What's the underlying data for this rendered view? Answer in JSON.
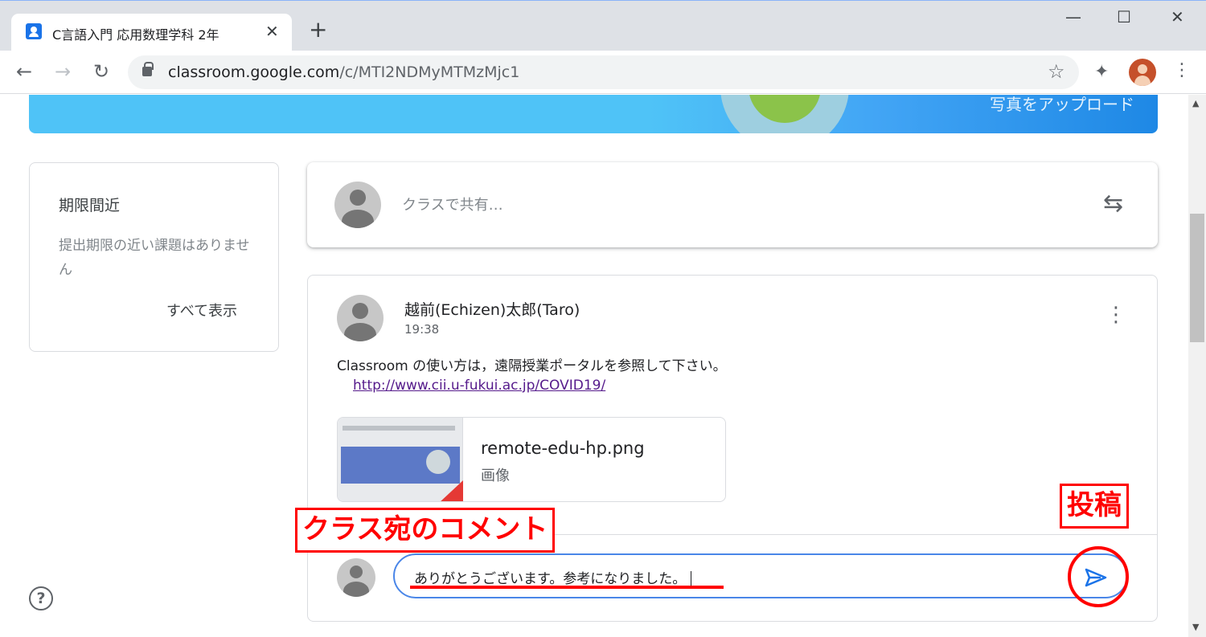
{
  "browser": {
    "tab_title": "C言語入門 応用数理学科 2年",
    "tab_close": "✕",
    "new_tab": "+",
    "window_minimize": "—",
    "window_maximize": "☐",
    "window_close": "✕",
    "url_host": "classroom.google.com",
    "url_path": "/c/MTI2NDMyMTMzMjc1"
  },
  "banner": {
    "upload_label": "写真をアップロード"
  },
  "upcoming": {
    "title": "期限間近",
    "body": "提出期限の近い課題はありません",
    "view_all": "すべて表示"
  },
  "share": {
    "placeholder": "クラスで共有…"
  },
  "post": {
    "author": "越前(Echizen)太郎(Taro)",
    "time": "19:38",
    "body": "Classroom の使い方は，遠隔授業ポータルを参照して下さい。",
    "link": "http://www.cii.u-fukui.ac.jp/COVID19/",
    "attachment": {
      "name": "remote-edu-hp.png",
      "type": "画像"
    },
    "comment_value": "ありがとうございます。参考になりました。"
  },
  "annotations": {
    "comment_label": "クラス宛のコメント",
    "send_label": "投稿",
    "color": "#ff0000"
  },
  "colors": {
    "accent_blue": "#1a73e8",
    "focus_blue": "#4a86e8",
    "banner_blue": "#4fc3f7"
  },
  "icons": [
    "back-icon",
    "forward-icon",
    "reload-icon",
    "lock-icon",
    "star-icon",
    "extensions-icon",
    "profile-avatar",
    "chrome-menu-icon",
    "repost-icon",
    "more-vert-icon",
    "send-icon",
    "help-icon"
  ]
}
